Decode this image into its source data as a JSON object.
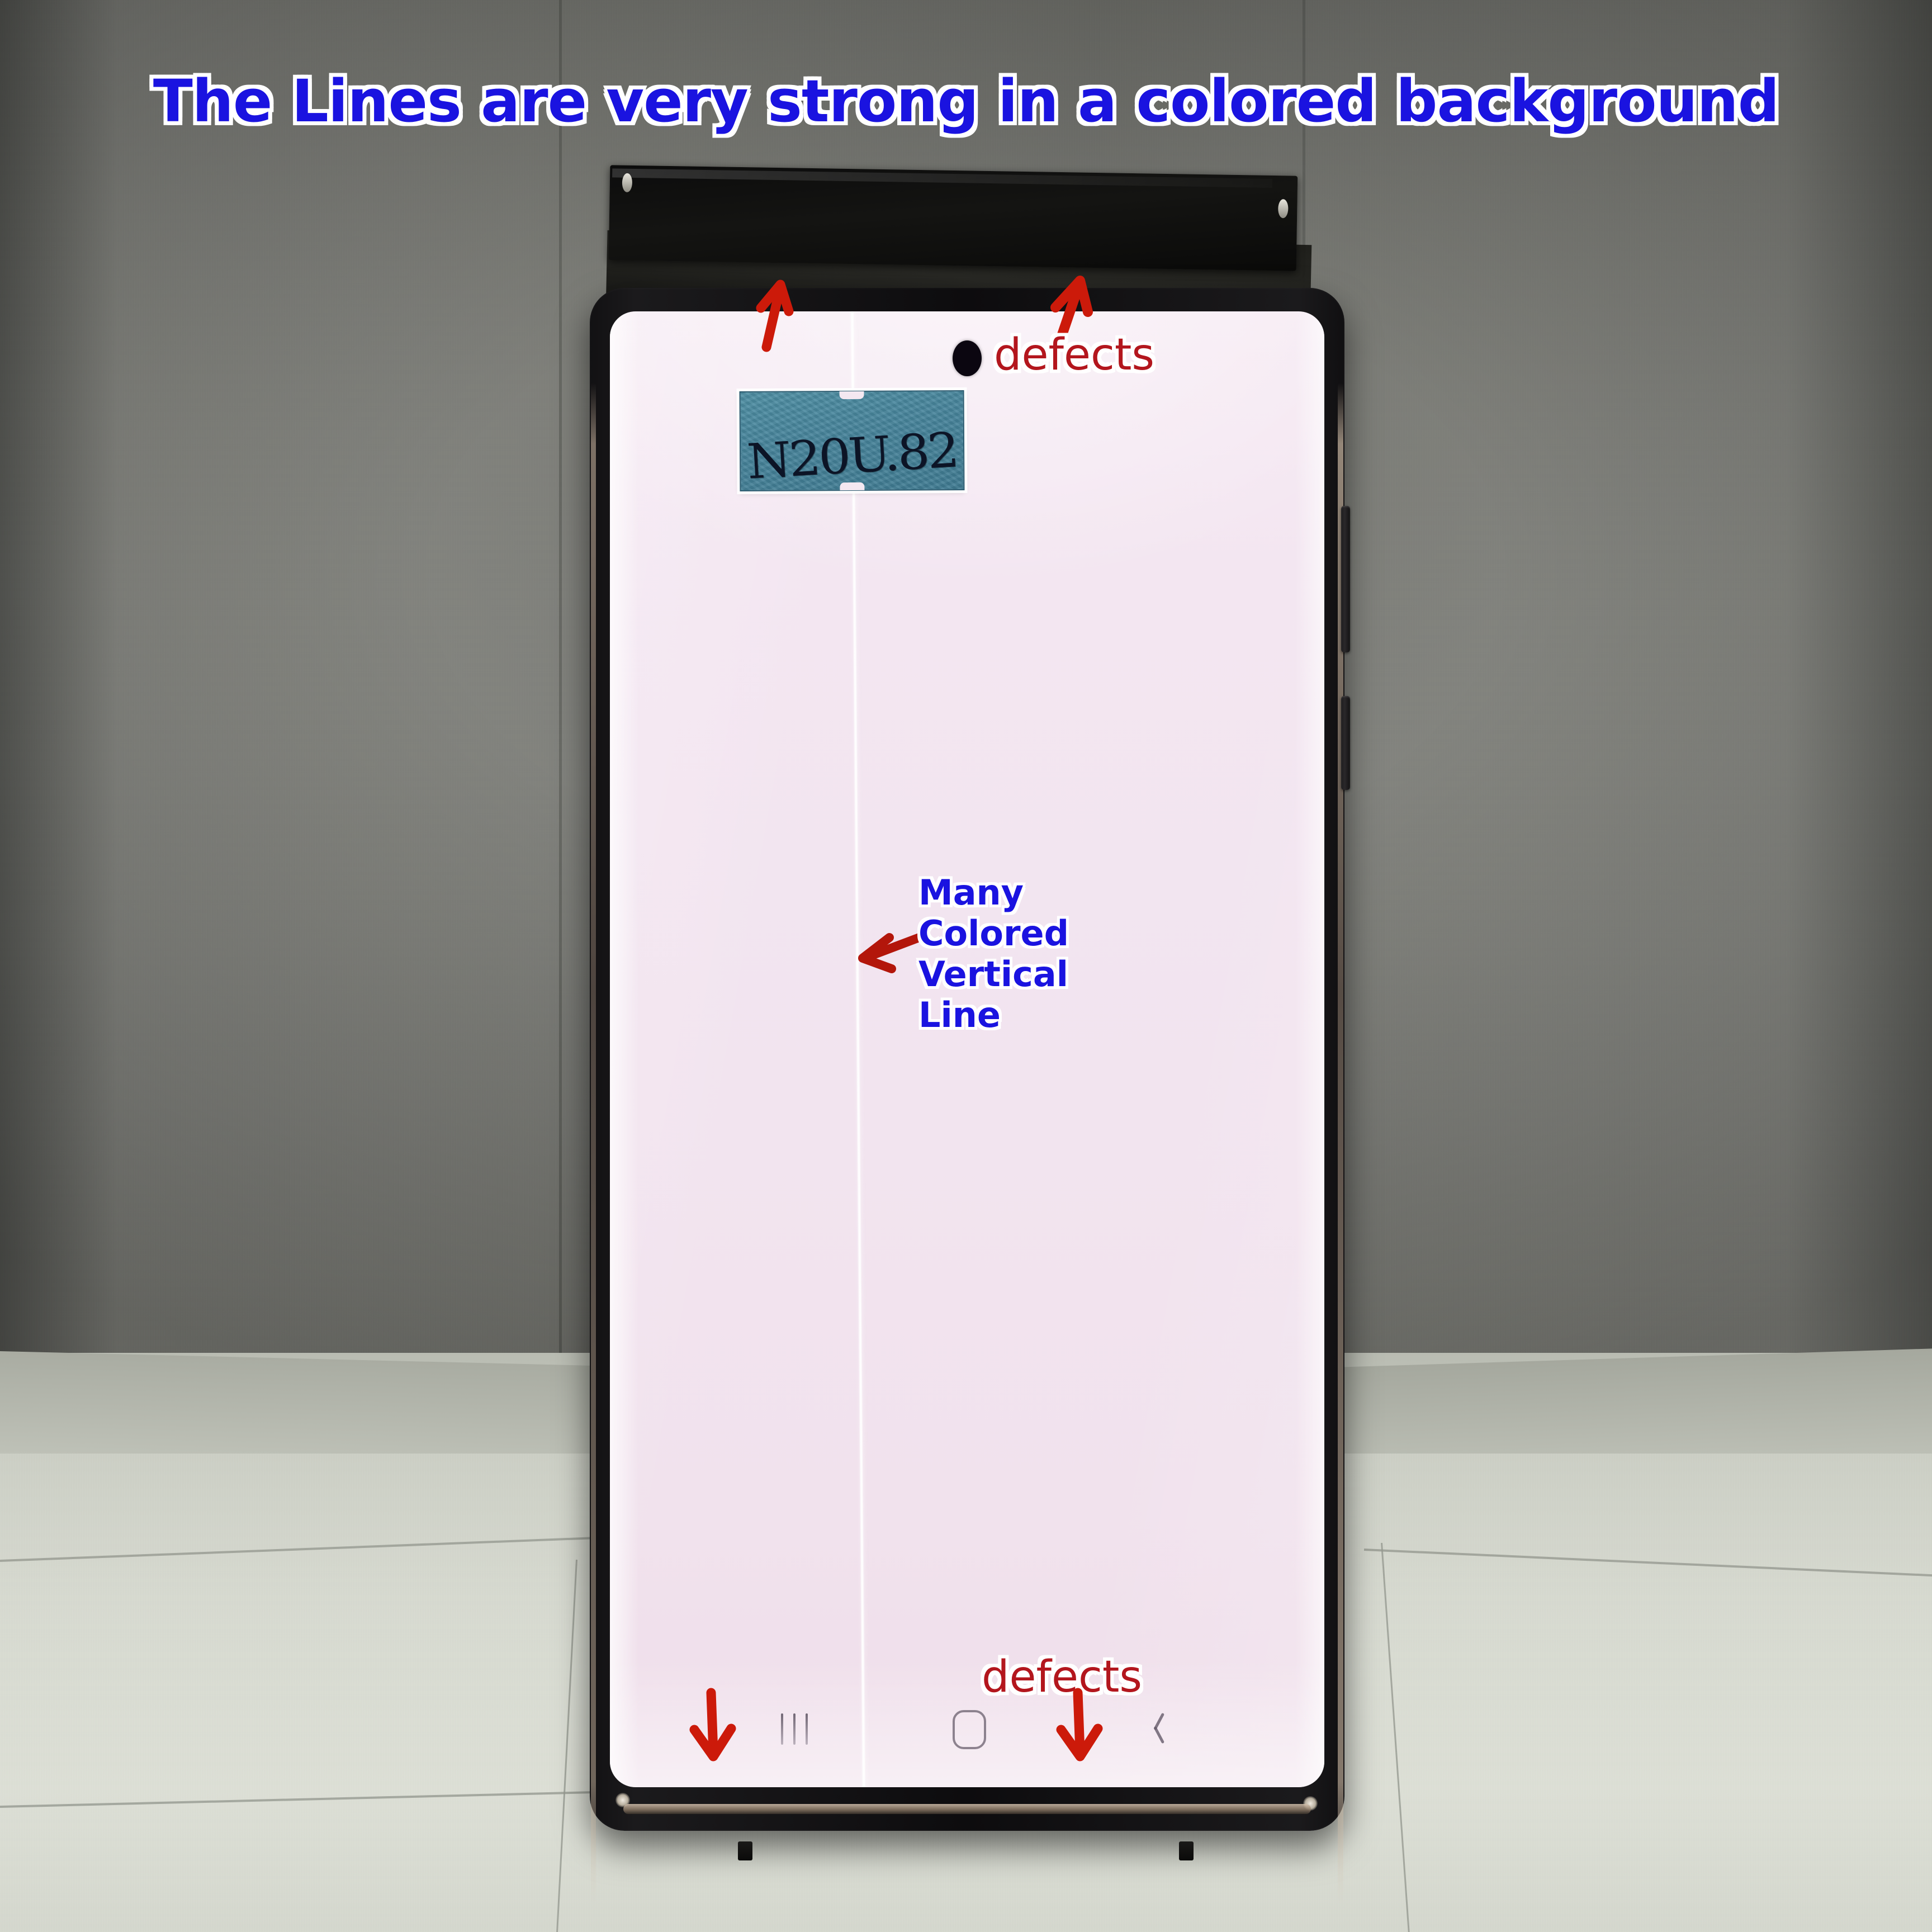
{
  "title": {
    "text": "The Lines are very strong in a colored background",
    "color": "#1a13e0",
    "outline_color": "#ffffff"
  },
  "colors": {
    "annotation_red": "#b3161d",
    "arrow_red": "#cc1a0a",
    "annotation_blue": "#1a13e0",
    "screen_background": "#f2e4ef",
    "sticker_blue": "#46839a",
    "phone_frame": "#121113",
    "wall": "#8a8b85",
    "floor": "#d9dcd2"
  },
  "device": {
    "type": "smartphone",
    "screen_fill_description": "solid pale pink test screen",
    "sticker": {
      "handwritten_text": "N20U.82",
      "background_color": "#46839a"
    },
    "nav_bar": {
      "recents_icon": "three-lines-icon",
      "home_icon": "rounded-square-home-icon",
      "back_icon": "chevron-left-back-icon"
    },
    "side_buttons": [
      "volume-rocker",
      "power-button"
    ]
  },
  "annotations": {
    "defects_top": "defects",
    "defects_bottom": "defects",
    "line_callout": [
      "Many",
      "Colored",
      "Vertical",
      "Line"
    ],
    "arrows": [
      {
        "name": "arrow-up-left-top",
        "direction": "up"
      },
      {
        "name": "arrow-up-right-top",
        "direction": "up"
      },
      {
        "name": "arrow-left-middle",
        "direction": "left"
      },
      {
        "name": "arrow-down-left-bottom",
        "direction": "down"
      },
      {
        "name": "arrow-down-right-bottom",
        "direction": "down"
      }
    ]
  }
}
